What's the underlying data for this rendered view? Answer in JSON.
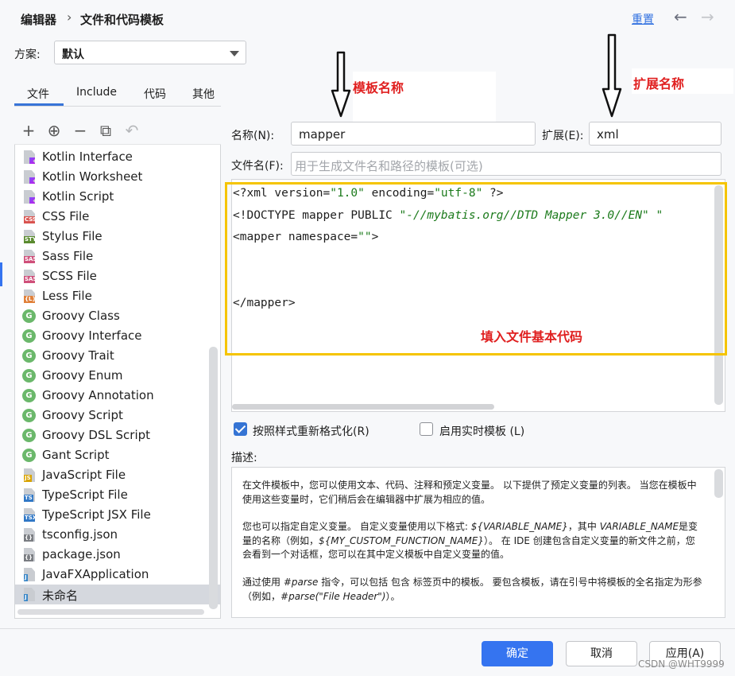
{
  "header": {
    "breadcrumb_root": "编辑器",
    "breadcrumb_sep": "›",
    "breadcrumb_current": "文件和代码模板",
    "reset_label": "重置",
    "back_arrow": "←",
    "forward_arrow": "→"
  },
  "scheme": {
    "label": "方案:",
    "value": "默认"
  },
  "tabs": [
    {
      "label": "文件",
      "active": true
    },
    {
      "label": "Include"
    },
    {
      "label": "代码"
    },
    {
      "label": "其他"
    }
  ],
  "toolbar": {
    "add": "+",
    "add_child": "⊕",
    "remove": "−",
    "copy": "⧉",
    "revert": "↶"
  },
  "templates": [
    {
      "label": "Kotlin Interface",
      "icon": "kotlin-file-icon"
    },
    {
      "label": "Kotlin Worksheet",
      "icon": "kotlin-file-icon"
    },
    {
      "label": "Kotlin Script",
      "icon": "kotlin-file-icon"
    },
    {
      "label": "CSS File",
      "icon": "css-file-icon",
      "badge": "CSS",
      "color": "#d9534f"
    },
    {
      "label": "Stylus File",
      "icon": "stylus-file-icon",
      "badge": "STYL",
      "color": "#5a8b2f"
    },
    {
      "label": "Sass File",
      "icon": "sass-file-icon",
      "badge": "SASS",
      "color": "#cf4f7a"
    },
    {
      "label": "SCSS File",
      "icon": "scss-file-icon",
      "badge": "SASS",
      "color": "#cf4f7a"
    },
    {
      "label": "Less File",
      "icon": "less-file-icon",
      "badge": "{L}",
      "color": "#e0803a"
    },
    {
      "label": "Groovy Class",
      "icon": "groovy-icon",
      "badge": "G"
    },
    {
      "label": "Groovy Interface",
      "icon": "groovy-icon",
      "badge": "G"
    },
    {
      "label": "Groovy Trait",
      "icon": "groovy-icon",
      "badge": "G"
    },
    {
      "label": "Groovy Enum",
      "icon": "groovy-icon",
      "badge": "G"
    },
    {
      "label": "Groovy Annotation",
      "icon": "groovy-icon",
      "badge": "G"
    },
    {
      "label": "Groovy Script",
      "icon": "groovy-icon",
      "badge": "G"
    },
    {
      "label": "Groovy DSL Script",
      "icon": "groovy-icon",
      "badge": "G"
    },
    {
      "label": "Gant Script",
      "icon": "groovy-icon",
      "badge": "G"
    },
    {
      "label": "JavaScript File",
      "icon": "javascript-file-icon",
      "badge": "JS",
      "color": "#d9a400"
    },
    {
      "label": "TypeScript File",
      "icon": "typescript-file-icon",
      "badge": "TS",
      "color": "#3178c6"
    },
    {
      "label": "TypeScript JSX File",
      "icon": "tsx-file-icon",
      "badge": "TSX",
      "color": "#3178c6"
    },
    {
      "label": "tsconfig.json",
      "icon": "json-file-icon",
      "badge": "{}",
      "color": "#7a7d82"
    },
    {
      "label": "package.json",
      "icon": "json-file-icon",
      "badge": "{}",
      "color": "#7a7d82"
    },
    {
      "label": "JavaFXApplication",
      "icon": "java-file-icon",
      "badge": "J",
      "color": "#3a87c7"
    },
    {
      "label": "未命名",
      "icon": "java-file-icon",
      "badge": "J",
      "color": "#3a87c7",
      "selected": true
    }
  ],
  "form": {
    "name_label": "名称(N):",
    "name_value": "mapper",
    "ext_label": "扩展(E):",
    "ext_value": "xml",
    "filename_label": "文件名(F):",
    "filename_placeholder": "用于生成文件名和路径的模板(可选)"
  },
  "editor": {
    "line1_a": "<?xml version=",
    "line1_b": "\"1.0\"",
    "line1_c": " encoding=",
    "line1_d": "\"utf-8\"",
    "line1_e": " ?>",
    "line2_a": "<!DOCTYPE mapper PUBLIC ",
    "line2_b": "\"-//mybatis.org//DTD Mapper 3.0//EN\"",
    "line2_c": " \"",
    "line3_a": "<mapper namespace=",
    "line3_b": "\"\"",
    "line3_c": ">",
    "line6": "</mapper>"
  },
  "annotations": {
    "template_name": "模板名称",
    "extension_name": "扩展名称",
    "fill_code": "填入文件基本代码",
    "arrow": "⇓"
  },
  "options": {
    "reformat_label": "按照样式重新格式化(R)",
    "reformat_checked": true,
    "live_template_label": "启用实时模板 (L)",
    "live_template_checked": false
  },
  "description": {
    "label": "描述:",
    "p1": "在文件模板中，您可以使用文本、代码、注释和预定义变量。 以下提供了预定义变量的列表。 当您在模板中使用这些变量时，它们稍后会在编辑器中扩展为相应的值。",
    "p2_a": "您也可以指定自定义变量。 自定义变量使用以下格式: ",
    "p2_b": "${VARIABLE_NAME}",
    "p2_c": "，其中 ",
    "p2_d": "VARIABLE_NAME",
    "p2_e": "是变量的名称（例如，",
    "p2_f": "${MY_CUSTOM_FUNCTION_NAME}",
    "p2_g": "）。 在 IDE 创建包含自定义变量的新文件之前，您会看到一个对话框，您可以在其中定义模板中自定义变量的值。",
    "p3_a": "通过使用 ",
    "p3_b": "#parse",
    "p3_c": " 指令，可以包括 包含 标签页中的模板。 要包含模板，请在引号中将模板的全名指定为形参（例如，",
    "p3_d": "#parse(\"File Header\")",
    "p3_e": "）。"
  },
  "footer": {
    "ok_label": "确定",
    "cancel_label": "取消",
    "apply_label": "应用(A)",
    "watermark": "CSDN @WHT9999"
  }
}
